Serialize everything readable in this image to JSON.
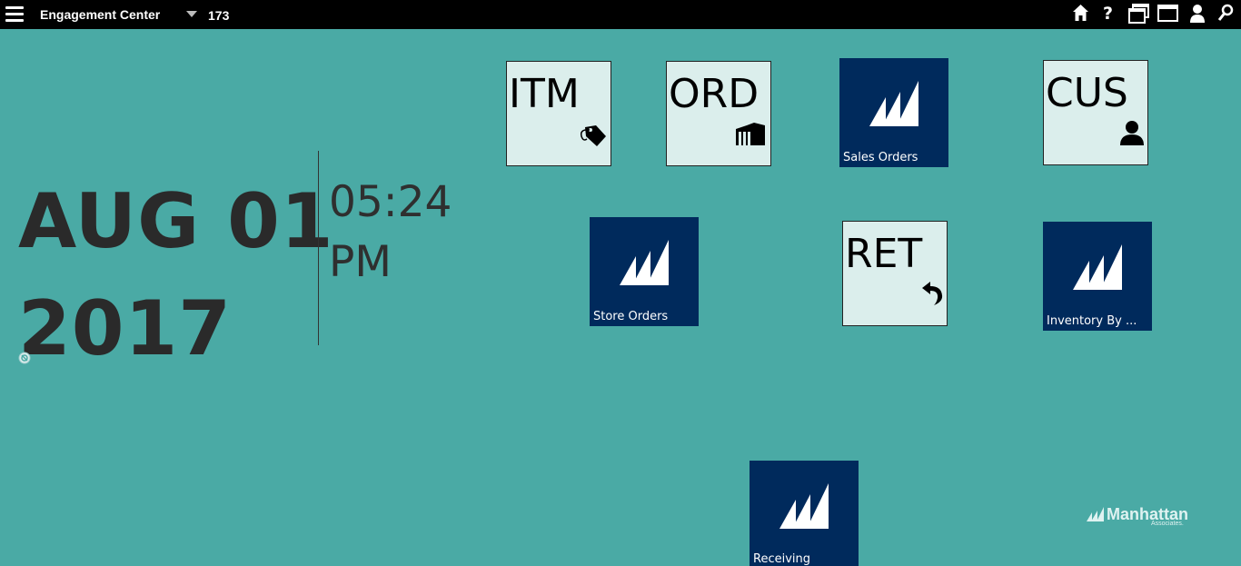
{
  "topbar": {
    "title": "Engagement Center",
    "location": "173",
    "icons": [
      "menu-icon",
      "home-icon",
      "help-icon",
      "windows-icon",
      "window-icon",
      "user-icon",
      "search-icon"
    ]
  },
  "clock": {
    "date_line1": "AUG 01",
    "date_line2": "2017",
    "time_line1": "05:24",
    "time_line2": "PM"
  },
  "tiles": {
    "itm": {
      "code": "ITM",
      "icon": "tag-icon"
    },
    "ord": {
      "code": "ORD",
      "icon": "warehouse-icon"
    },
    "sales_orders": {
      "label": "Sales Orders",
      "icon": "manhattan-logo-icon"
    },
    "cus": {
      "code": "CUS",
      "icon": "person-icon"
    },
    "store_orders": {
      "label": "Store Orders",
      "icon": "manhattan-logo-icon"
    },
    "ret": {
      "code": "RET",
      "icon": "return-arrow-icon"
    },
    "inventory": {
      "label": "Inventory By ...",
      "icon": "manhattan-logo-icon"
    },
    "receiving": {
      "label": "Receiving",
      "icon": "manhattan-logo-icon"
    }
  },
  "brand": {
    "name": "Manhattan",
    "sub": "Associates."
  },
  "colors": {
    "background": "#4aaaa5",
    "tile_dark": "#002a5c",
    "tile_light": "#dbeeec",
    "topbar": "#000000"
  }
}
